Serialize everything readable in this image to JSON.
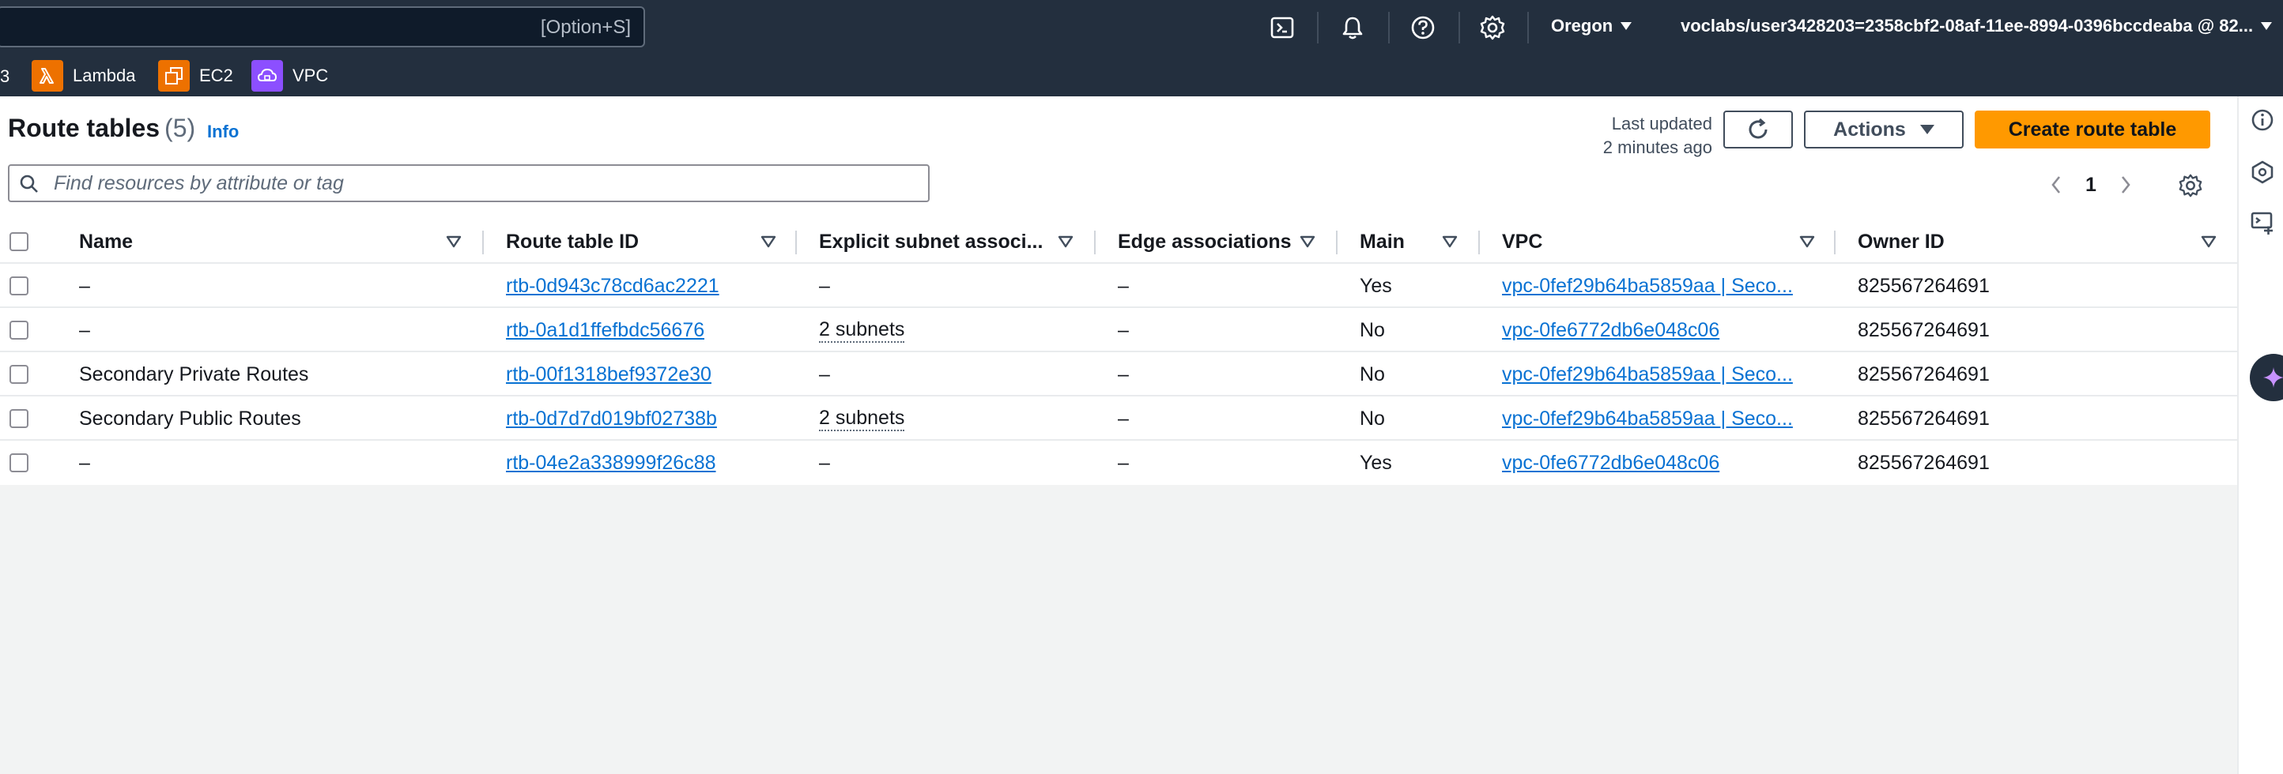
{
  "topbar": {
    "search_shortcut": "[Option+S]",
    "region": "Oregon",
    "account": "voclabs/user3428203=2358cbf2-08af-11ee-8994-0396bccdeaba @ 82..."
  },
  "favorites": {
    "partial": "3",
    "items": [
      {
        "label": "Lambda",
        "color": "#ed7100"
      },
      {
        "label": "EC2",
        "color": "#ed7100"
      },
      {
        "label": "VPC",
        "color": "#8c4fff"
      }
    ]
  },
  "header": {
    "title": "Route tables",
    "count": "(5)",
    "info": "Info",
    "last_updated_line1": "Last updated",
    "last_updated_line2": "2 minutes ago",
    "actions_label": "Actions",
    "create_label": "Create route table"
  },
  "filter": {
    "placeholder": "Find resources by attribute or tag"
  },
  "pagination": {
    "page": "1"
  },
  "columns": [
    "Name",
    "Route table ID",
    "Explicit subnet associ...",
    "Edge associations",
    "Main",
    "VPC",
    "Owner ID"
  ],
  "rows": [
    {
      "name": "–",
      "id": "rtb-0d943c78cd6ac2221",
      "subnet": "–",
      "edge": "–",
      "main": "Yes",
      "vpc": "vpc-0fef29b64ba5859aa | Seco...",
      "owner": "825567264691"
    },
    {
      "name": "–",
      "id": "rtb-0a1d1ffefbdc56676",
      "subnet": "2 subnets",
      "edge": "–",
      "main": "No",
      "vpc": "vpc-0fe6772db6e048c06",
      "owner": "825567264691"
    },
    {
      "name": "Secondary Private Routes",
      "id": "rtb-00f1318bef9372e30",
      "subnet": "–",
      "edge": "–",
      "main": "No",
      "vpc": "vpc-0fef29b64ba5859aa | Seco...",
      "owner": "825567264691"
    },
    {
      "name": "Secondary Public Routes",
      "id": "rtb-0d7d7d019bf02738b",
      "subnet": "2 subnets",
      "edge": "–",
      "main": "No",
      "vpc": "vpc-0fef29b64ba5859aa | Seco...",
      "owner": "825567264691"
    },
    {
      "name": "–",
      "id": "rtb-04e2a338999f26c88",
      "subnet": "–",
      "edge": "–",
      "main": "Yes",
      "vpc": "vpc-0fe6772db6e048c06",
      "owner": "825567264691"
    }
  ],
  "colors": {
    "accent": "#ff9900",
    "link": "#0972d3",
    "nav": "#232f3e"
  }
}
